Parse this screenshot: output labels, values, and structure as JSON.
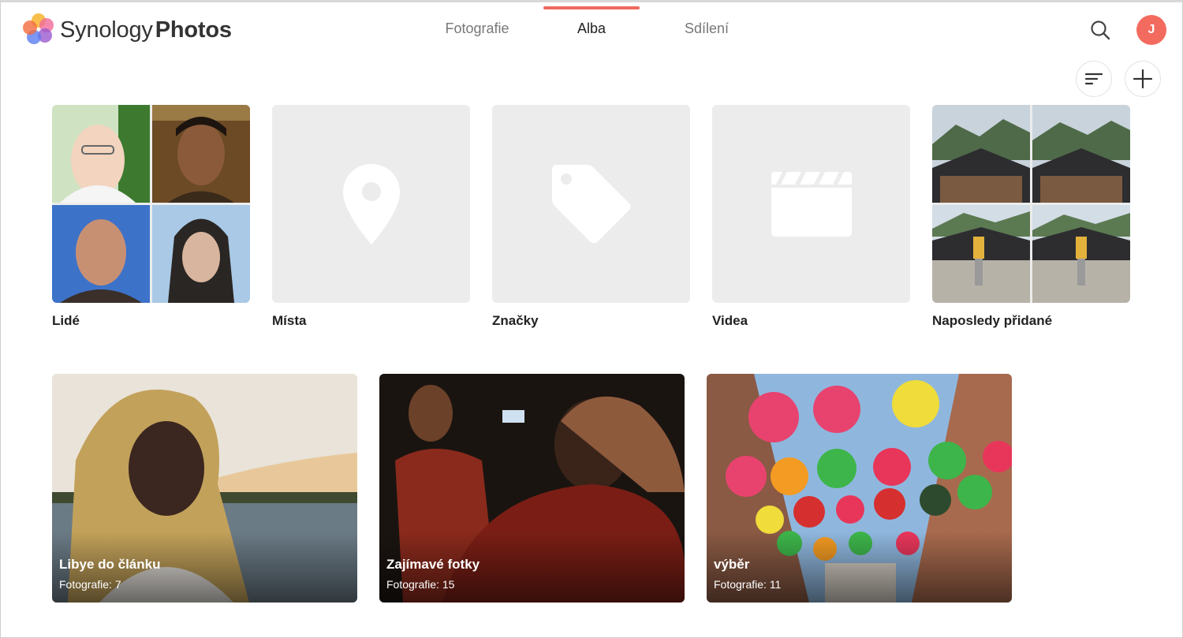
{
  "app": {
    "brand_light": "Synology",
    "brand_bold": "Photos",
    "accent": "#f06a5e"
  },
  "nav": {
    "tabs": [
      {
        "label": "Fotografie",
        "active": false
      },
      {
        "label": "Alba",
        "active": true
      },
      {
        "label": "Sdílení",
        "active": false
      }
    ]
  },
  "header": {
    "search_icon": "search-icon",
    "avatar_letter": "J",
    "avatar_color": "#f36b5f"
  },
  "toolbar": {
    "sort_icon": "sort-icon",
    "add_icon": "plus-icon"
  },
  "categories": [
    {
      "label": "Lidé",
      "icon": "people-collage"
    },
    {
      "label": "Místa",
      "icon": "location-pin-icon"
    },
    {
      "label": "Značky",
      "icon": "tag-icon"
    },
    {
      "label": "Videa",
      "icon": "clapperboard-icon"
    },
    {
      "label": "Naposledy přidané",
      "icon": "recent-collage"
    }
  ],
  "albums": [
    {
      "title": "Libye do článku",
      "count": "Fotografie: 7"
    },
    {
      "title": "Zajímavé fotky",
      "count": "Fotografie: 15"
    },
    {
      "title": "výběr",
      "count": "Fotografie: 11"
    }
  ]
}
